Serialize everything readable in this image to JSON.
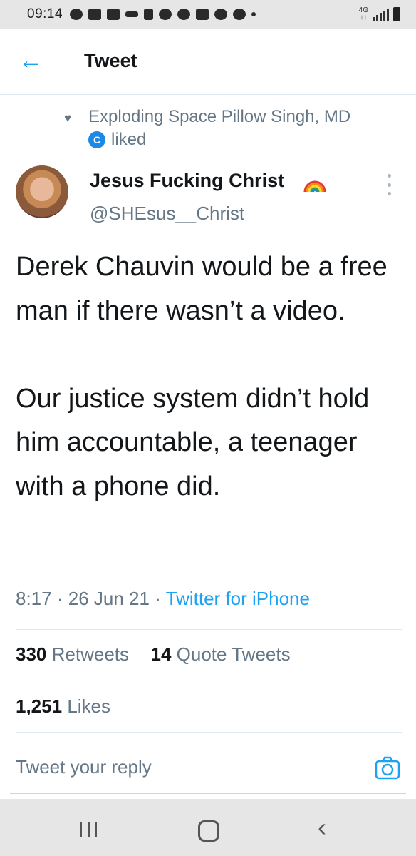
{
  "status_bar": {
    "time": "09:14"
  },
  "app_bar": {
    "title": "Tweet"
  },
  "social_context": {
    "liker_name": "Exploding Space Pillow Singh, MD",
    "action": "liked"
  },
  "tweet": {
    "author_name": "Jesus Fucking Christ",
    "author_handle": "@SHEsus__Christ",
    "paragraphs": [
      "Derek Chauvin would be a free man if there wasn’t a video.",
      "Our justice system didn’t hold him accountable, a teenager with a phone did."
    ],
    "time": "8:17",
    "separator": "·",
    "date": "26 Jun 21",
    "source": "Twitter for iPhone"
  },
  "stats": {
    "retweets_count": "330",
    "retweets_label": "Retweets",
    "quote_tweets_count": "14",
    "quote_tweets_label": "Quote Tweets",
    "likes_count": "1,251",
    "likes_label": "Likes"
  },
  "reply": {
    "placeholder": "Tweet your reply"
  },
  "colors": {
    "accent": "#1da1f2",
    "secondary_text": "#657786",
    "system_bar": "#e6e6e6"
  }
}
